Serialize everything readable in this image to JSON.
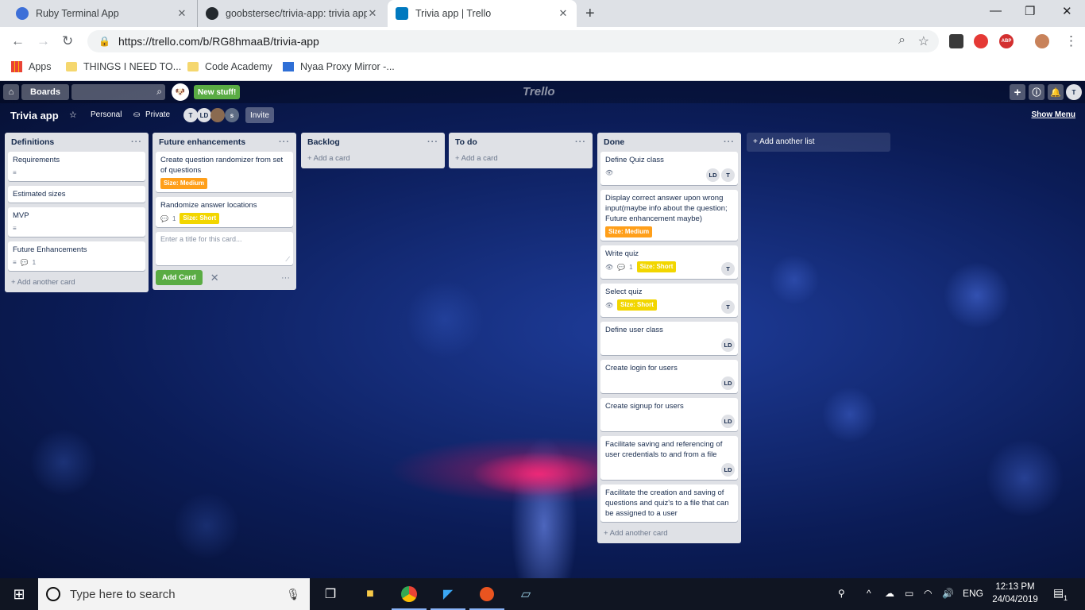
{
  "browser": {
    "tabs": [
      {
        "title": "Ruby Terminal App",
        "icon": "app-icon",
        "active": false
      },
      {
        "title": "goobstersec/trivia-app: trivia app",
        "icon": "github-icon",
        "active": false
      },
      {
        "title": "Trivia app | Trello",
        "icon": "trello-icon",
        "active": true
      }
    ],
    "url": "https://trello.com/b/RG8hmaaB/trivia-app",
    "bookmarks": [
      "Apps",
      "THINGS I NEED TO...",
      "Code Academy",
      "Nyaa Proxy Mirror -..."
    ],
    "extensions": [
      "notes-icon",
      "stop-icon",
      "abp-icon",
      "avatar-icon"
    ],
    "abp_label": "ABP"
  },
  "trello": {
    "boards_label": "Boards",
    "new_stuff": "New stuff!",
    "logo": "Trello",
    "board_title": "Trivia app",
    "team": "Personal",
    "visibility": "Private",
    "members": [
      "T",
      "LD",
      "",
      "s"
    ],
    "invite": "Invite",
    "show_menu": "Show Menu",
    "add_another_list": "+ Add another list",
    "lists": [
      {
        "title": "Definitions",
        "cards": [
          {
            "title": "Requirements",
            "desc": true
          },
          {
            "title": "Estimated sizes"
          },
          {
            "title": "MVP",
            "desc": true
          },
          {
            "title": "Future Enhancements",
            "desc": true,
            "comments": "1"
          }
        ],
        "footer": "+ Add another card"
      },
      {
        "title": "Future enhancements",
        "cards": [
          {
            "title": "Create question randomizer from set of questions",
            "label": "Size: Medium",
            "label_color": "orange"
          },
          {
            "title": "Randomize answer locations",
            "comments": "1",
            "label": "Size: Short",
            "label_color": "yellow"
          }
        ],
        "composer_placeholder": "Enter a title for this card...",
        "add_card_button": "Add Card"
      },
      {
        "title": "Backlog",
        "cards": [],
        "footer": "+ Add a card"
      },
      {
        "title": "To do",
        "cards": [],
        "footer": "+ Add a card"
      },
      {
        "title": "Done",
        "cards": [
          {
            "title": "Define Quiz class",
            "watch": true,
            "members": [
              "LD",
              "T"
            ]
          },
          {
            "title": "Display correct answer upon wrong input(maybe info about the question; Future enhancement maybe)",
            "label": "Size: Medium",
            "label_color": "orange"
          },
          {
            "title": "Write quiz",
            "watch": true,
            "comments": "1",
            "label": "Size: Short",
            "label_color": "yellow",
            "members": [
              "T"
            ]
          },
          {
            "title": "Select quiz",
            "watch": true,
            "label": "Size: Short",
            "label_color": "yellow",
            "members": [
              "T"
            ]
          },
          {
            "title": "Define user class",
            "members": [
              "LD"
            ]
          },
          {
            "title": "Create login for users",
            "members": [
              "LD"
            ]
          },
          {
            "title": "Create signup for users",
            "members": [
              "LD"
            ]
          },
          {
            "title": "Facilitate saving and referencing of user credentials to and from a file",
            "members": [
              "LD"
            ]
          },
          {
            "title": "Facilitate the creation and saving of questions and quiz's to a file that can be assigned to a user"
          }
        ],
        "footer": "+ Add another card"
      }
    ]
  },
  "taskbar": {
    "search_placeholder": "Type here to search",
    "apps": [
      "task-view-icon",
      "file-explorer-icon",
      "chrome-icon",
      "vscode-icon",
      "ubuntu-icon",
      "notepad-icon"
    ],
    "language": "ENG",
    "time": "12:13 PM",
    "date": "24/04/2019",
    "notifications": "1"
  },
  "colors": {
    "accent_green": "#5aac44",
    "label_orange": "#ff9f1a",
    "label_yellow": "#f2d600"
  }
}
